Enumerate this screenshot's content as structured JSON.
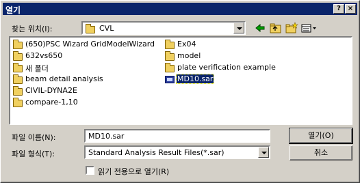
{
  "window": {
    "title": "열기",
    "help_glyph": "?",
    "close_glyph": "×"
  },
  "lookin": {
    "label": "찾는 위치(I):",
    "value": "CVL"
  },
  "toolbar": {
    "back_icon": "back-arrow-icon",
    "up_icon": "up-folder-icon",
    "new_folder_icon": "new-folder-icon",
    "view_menu_icon": "view-menu-icon"
  },
  "files": {
    "col1": [
      "(650)PSC Wizard GridModelWizard",
      "632vs650",
      "새 폴더",
      "beam detail analysis",
      "CIVIL-DYNA2E",
      "compare-1,10"
    ],
    "col2": [
      "Ex04",
      "model",
      "plate verification example",
      "MD10.sar"
    ],
    "selected": "MD10.sar"
  },
  "filename": {
    "label": "파일 이름(N):",
    "value": "MD10.sar"
  },
  "filetype": {
    "label": "파일 형식(T):",
    "value": "Standard Analysis Result Files(*.sar)"
  },
  "buttons": {
    "open": "열기(O)",
    "cancel": "취소"
  },
  "readonly": {
    "label": "읽기 전용으로 열기(R)",
    "checked": false
  },
  "colors": {
    "title_bg": "#0a246a",
    "face": "#d4d0c8",
    "selection": "#0a246a"
  }
}
